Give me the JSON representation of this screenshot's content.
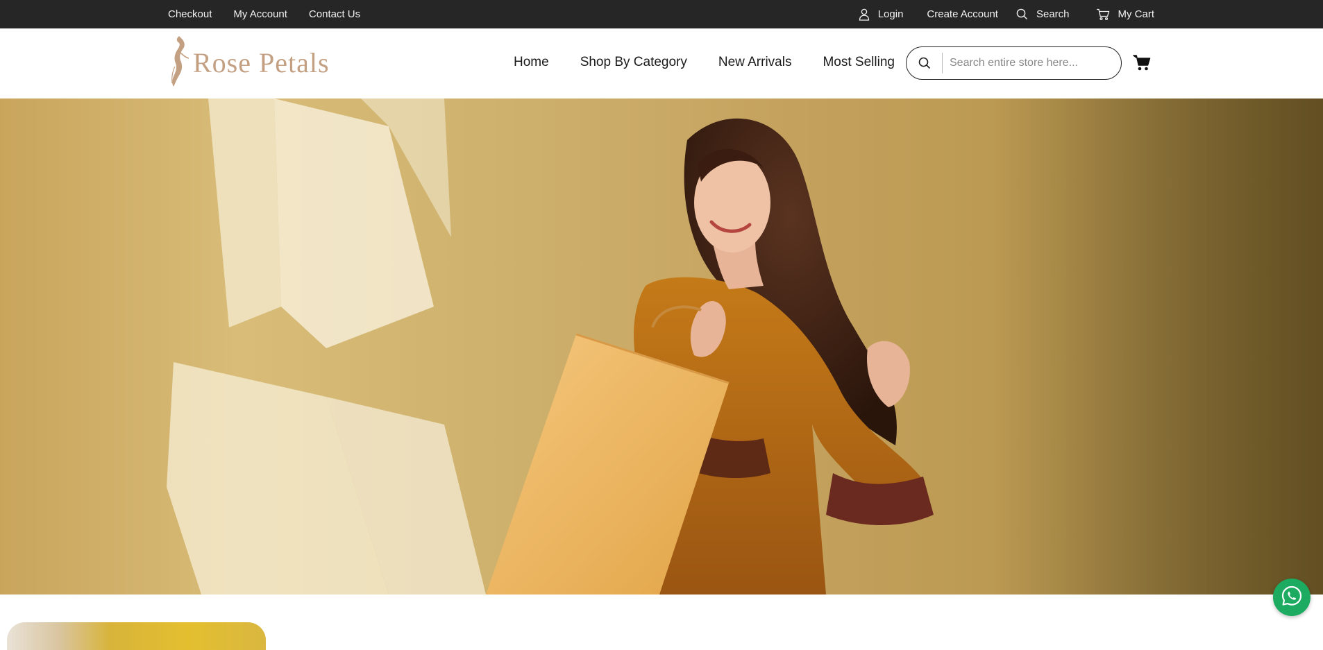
{
  "topbar": {
    "left_links": [
      "Checkout",
      "My Account",
      "Contact Us"
    ],
    "login": "Login",
    "create_account": "Create Account",
    "search": "Search",
    "my_cart": "My Cart"
  },
  "header": {
    "logo_text": "Rose Petals",
    "nav": [
      "Home",
      "Shop By Category",
      "New Arrivals",
      "Most Selling"
    ],
    "search_placeholder": "Search entire store here..."
  },
  "icons": {
    "user": "user-icon",
    "search": "search-icon",
    "cart": "cart-icon",
    "whatsapp": "whatsapp-icon"
  },
  "colors": {
    "topbar_bg": "#262626",
    "logo": "#c4a083",
    "whatsapp": "#1daa61"
  }
}
